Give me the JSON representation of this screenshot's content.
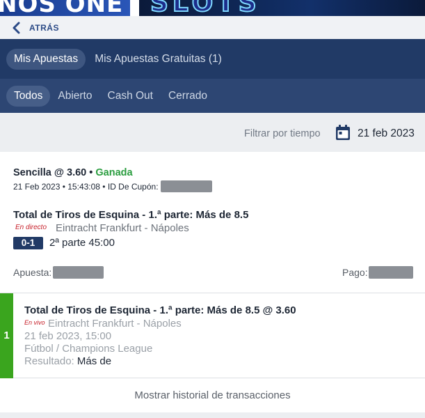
{
  "banner": {
    "left_text": "NOS ONE",
    "right_text": "SLOTS"
  },
  "back": {
    "label": "ATRÁS"
  },
  "main_tabs": [
    {
      "label": "Mis Apuestas",
      "active": true
    },
    {
      "label": "Mis Apuestas Gratuitas (1)",
      "active": false
    }
  ],
  "filter_tabs": [
    {
      "label": "Todos",
      "active": true
    },
    {
      "label": "Abierto",
      "active": false
    },
    {
      "label": "Cash Out",
      "active": false
    },
    {
      "label": "Cerrado",
      "active": false
    }
  ],
  "filter": {
    "label": "Filtrar por tiempo",
    "date": "21 feb 2023",
    "icon": "calendar-icon"
  },
  "bet": {
    "type": "Sencilla @ 3.60",
    "separator": "•",
    "status": "Ganada",
    "datetime": "21 Feb 2023 • 15:43:08 • ID De Cupón:",
    "market": "Total de Tiros de Esquina - 1.ª parte: Más de 8.5",
    "live_tag": "En directo",
    "event": "Eintracht Frankfurt - Nápoles",
    "score": "0-1",
    "period": "2ª parte 45:00",
    "stake_label": "Apuesta:",
    "payout_label": "Pago:"
  },
  "selection": {
    "number": "1",
    "title": "Total de Tiros de Esquina - 1.ª parte: Más de 8.5 @ 3.60",
    "live_tag": "En vivo",
    "event": "Eintracht Frankfurt - Nápoles",
    "datetime": "21 feb 2023, 15:00",
    "competition": "Fútbol / Champions League",
    "result_label": "Resultado:",
    "result_value": "Más de"
  },
  "history": {
    "label": "Mostrar historial de transacciones"
  },
  "colors": {
    "header_dark": "#213a66",
    "header_mid": "#2d4673",
    "won_green": "#2a9d3f",
    "live_red": "#c7202a",
    "selection_bar": "#3aa51e"
  }
}
